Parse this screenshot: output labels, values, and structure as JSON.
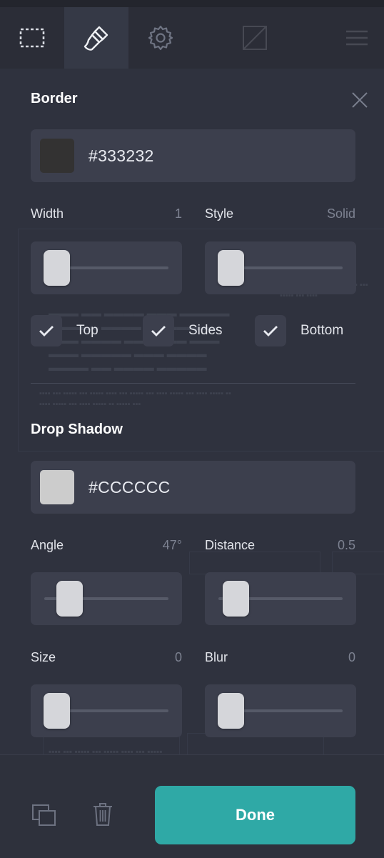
{
  "toolbar": {
    "tools": [
      {
        "name": "selection-marquee-icon"
      },
      {
        "name": "paintbrush-icon"
      },
      {
        "name": "gear-icon"
      },
      {
        "name": "image-icon"
      },
      {
        "name": "menu-icon"
      }
    ]
  },
  "border": {
    "title": "Border",
    "color_hex": "#333232",
    "swatch_color": "#333232",
    "width_label": "Width",
    "width_value": "1",
    "style_label": "Style",
    "style_value": "Solid",
    "width_slider_level": 0,
    "style_slider_level": 0,
    "checks": [
      {
        "label": "Top",
        "checked": true
      },
      {
        "label": "Sides",
        "checked": true
      },
      {
        "label": "Bottom",
        "checked": true
      }
    ]
  },
  "shadow": {
    "title": "Drop Shadow",
    "color_hex": "#CCCCCC",
    "swatch_color": "#CCCCCC",
    "angle_label": "Angle",
    "angle_value": "47°",
    "distance_label": "Distance",
    "distance_value": "0.5",
    "size_label": "Size",
    "size_value": "0",
    "blur_label": "Blur",
    "blur_value": "0"
  },
  "footer": {
    "done_label": "Done"
  },
  "colors": {
    "accent": "#2fa9a6",
    "panel": "#2f323e",
    "field": "#3c3f4d"
  }
}
